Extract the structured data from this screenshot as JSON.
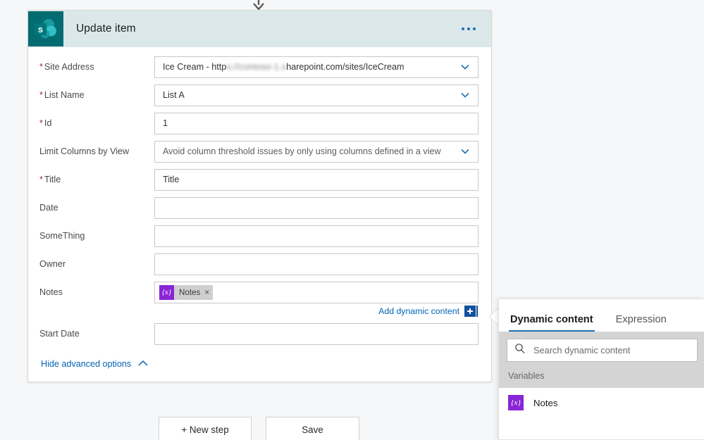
{
  "connector": {
    "icon": "arrow-down-icon"
  },
  "card": {
    "logo_icon": "sharepoint-logo-icon",
    "title": "Update item",
    "menu_icon": "more-options-icon",
    "fields": [
      {
        "label": "Site Address",
        "required": true,
        "value_prefix": "Ice Cream - http",
        "value_blurred": "s://contoso-1.s",
        "value_suffix": "harepoint.com/sites/IceCream",
        "type": "dropdown"
      },
      {
        "label": "List Name",
        "required": true,
        "value": "List A",
        "type": "dropdown"
      },
      {
        "label": "Id",
        "required": true,
        "value": "1",
        "type": "text"
      },
      {
        "label": "Limit Columns by View",
        "required": false,
        "value": "Avoid column threshold issues by only using columns defined in a view",
        "type": "dropdown"
      },
      {
        "label": "Title",
        "required": true,
        "value": "Title",
        "type": "text"
      },
      {
        "label": "Date",
        "required": false,
        "value": "",
        "type": "text"
      },
      {
        "label": "SomeThing",
        "required": false,
        "value": "",
        "type": "text"
      },
      {
        "label": "Owner",
        "required": false,
        "value": "",
        "type": "text"
      }
    ],
    "notes_field": {
      "label": "Notes",
      "token_icon_glyph": "{x}",
      "token_text": "Notes",
      "token_remove_glyph": "×"
    },
    "add_dynamic_content": {
      "label": "Add dynamic content",
      "button_icon": "plus-icon"
    },
    "start_date_field": {
      "label": "Start Date",
      "value": ""
    },
    "advanced_toggle": {
      "label": "Hide advanced options",
      "icon": "chevron-up-icon"
    }
  },
  "footer": {
    "new_step_label": "+ New step",
    "save_label": "Save"
  },
  "panel": {
    "tabs": [
      {
        "label": "Dynamic content",
        "active": true
      },
      {
        "label": "Expression",
        "active": false
      }
    ],
    "search": {
      "icon": "search-icon",
      "placeholder": "Search dynamic content",
      "value": ""
    },
    "section_label": "Variables",
    "items": [
      {
        "icon_glyph": "{x}",
        "label": "Notes"
      }
    ]
  },
  "colors": {
    "sharepoint_teal": "#036c70",
    "header_band": "#dbe8ea",
    "accent_blue": "#1f6fb2",
    "link_blue": "#0264b5",
    "required_red": "#a4262c",
    "variable_purple": "#8a25d6",
    "panel_band_gray": "#d4d4d4"
  }
}
